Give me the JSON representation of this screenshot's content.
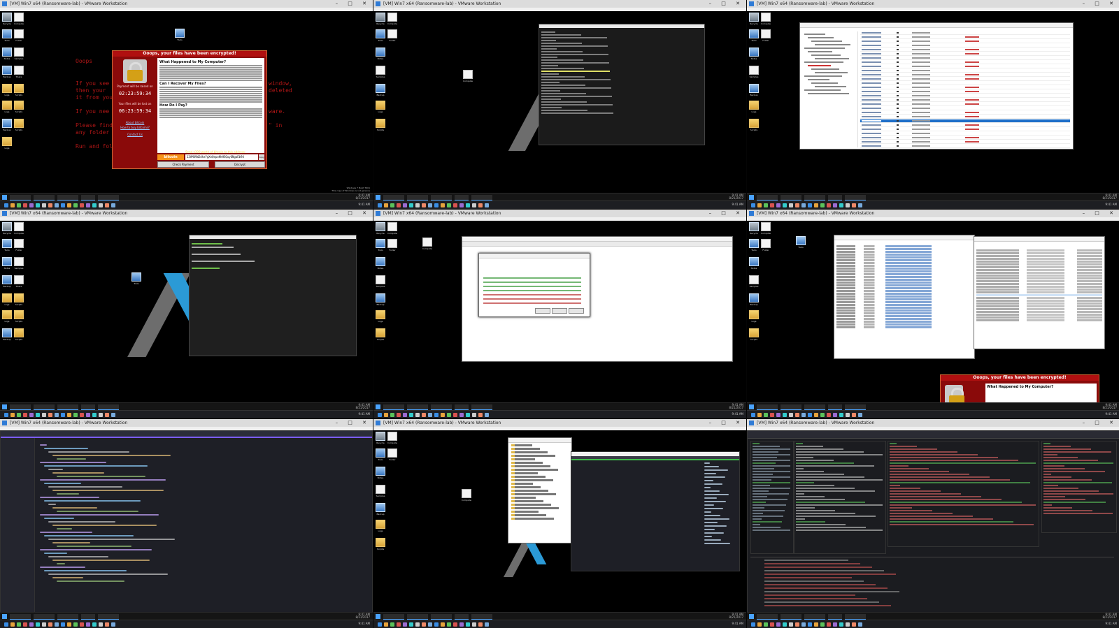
{
  "vm_window_title": "[VM] Win7 x64 (Ransomware-lab) - VMware Workstation",
  "desktop_icons": [
    "Recycle Bin",
    "Computer",
    "Tools",
    "Folder",
    "Notes",
    "Samples",
    "Backup",
    "Share",
    "Logs",
    "Scripts"
  ],
  "tile1": {
    "ransom_bg_lines": [
      "Ooops",
      "If you see",
      "then your",
      "it from you",
      "If you nee",
      "Please find",
      "any folder",
      "Run and fol"
    ],
    "ransom_bg_right": [
      "window,",
      "deleted",
      "ware.",
      "\" in"
    ],
    "wannacry": {
      "title": "Ooops, your files have been encrypted!",
      "language": "English",
      "h1": "What Happened to My Computer?",
      "h2": "Can I Recover My Files?",
      "h3": "How Do I Pay?",
      "raise_label": "Payment will be raised on",
      "timer1": "02:23:59:34",
      "lost_label": "Your files will be lost on",
      "timer2": "06:23:59:34",
      "bitcoin": "bitcoin",
      "send_label": "Send $300 worth of bitcoin to this address:",
      "address": "13AM4VW2dhxYgXeQepoHkHSQuy6NgaEb94",
      "copy": "Copy",
      "link_about": "About bitcoin",
      "link_how": "How to buy bitcoins?",
      "link_contact": "Contact Us",
      "check_payment": "Check Payment",
      "decrypt": "Decrypt"
    }
  },
  "tile8_dialog": {
    "title": "Ooops, your files have been encrypted!",
    "h1": "What Happened to My Computer?"
  },
  "host_clock": [
    "9:41 AM",
    "8/21/2017"
  ],
  "vm_status_notice": [
    "Windows 7 Build 7601",
    "This copy of Windows is not genuine"
  ]
}
